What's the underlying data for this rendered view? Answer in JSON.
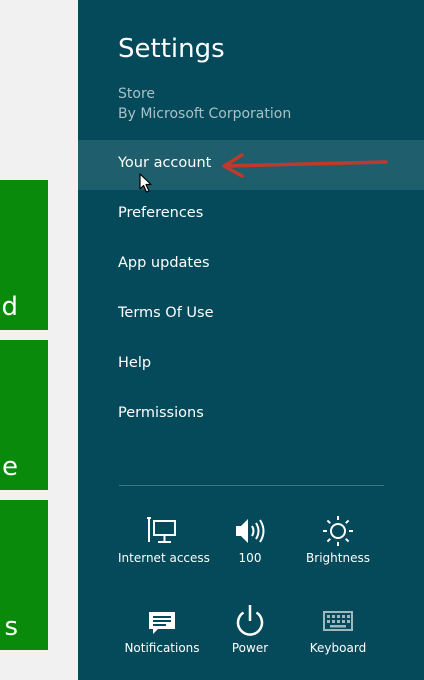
{
  "background": {
    "tiles": [
      {
        "text": "d"
      },
      {
        "text": "e"
      },
      {
        "text": "s"
      }
    ]
  },
  "settings": {
    "title": "Settings",
    "app_name": "Store",
    "app_publisher": "By Microsoft Corporation",
    "items": [
      {
        "label": "Your account"
      },
      {
        "label": "Preferences"
      },
      {
        "label": "App updates"
      },
      {
        "label": "Terms Of Use"
      },
      {
        "label": "Help"
      },
      {
        "label": "Permissions"
      }
    ]
  },
  "quick_settings": {
    "internet": {
      "label": "Internet access",
      "icon": "network-icon"
    },
    "volume": {
      "label": "100",
      "icon": "speaker-icon"
    },
    "brightness": {
      "label": "Brightness",
      "icon": "brightness-icon"
    },
    "notifications": {
      "label": "Notifications",
      "icon": "notifications-icon"
    },
    "power": {
      "label": "Power",
      "icon": "power-icon"
    },
    "keyboard": {
      "label": "Keyboard",
      "icon": "keyboard-icon"
    }
  },
  "colors": {
    "pane": "#044a5a",
    "hover": "#1f5e6d",
    "tile": "#0a8a0a",
    "arrow": "#c0392b"
  }
}
